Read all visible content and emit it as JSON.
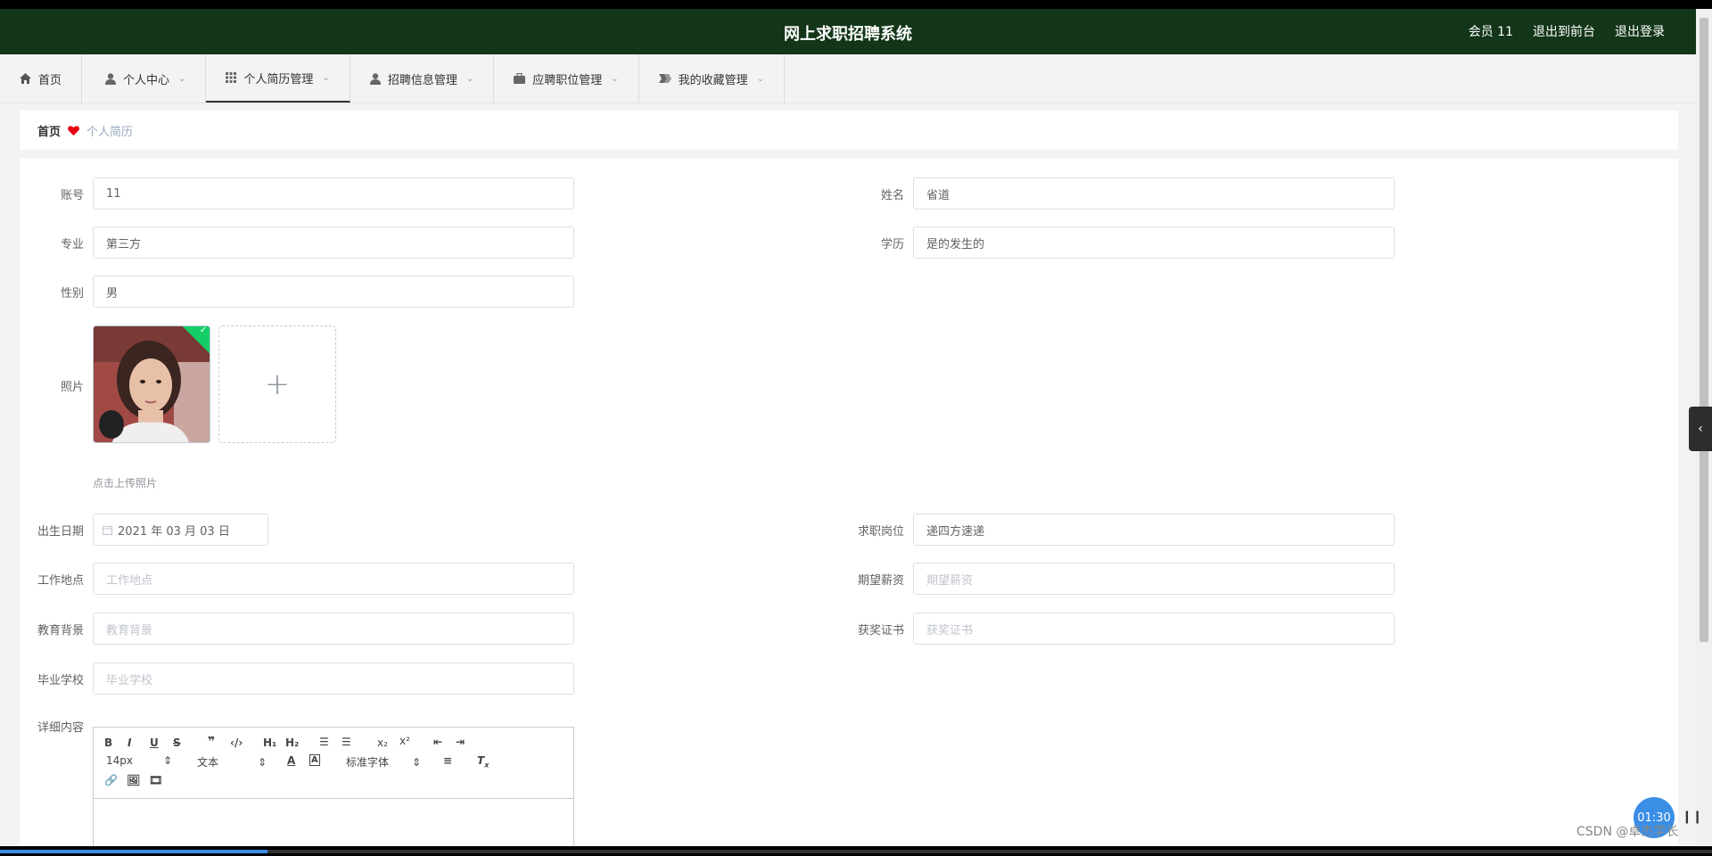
{
  "header": {
    "title": "网上求职招聘系统",
    "member": "会员 11",
    "exit_front": "退出到前台",
    "logout": "退出登录",
    "bg_color": "#133619"
  },
  "nav": {
    "items": [
      {
        "label": "首页",
        "icon": "home-icon"
      },
      {
        "label": "个人中心",
        "icon": "user-icon"
      },
      {
        "label": "个人简历管理",
        "icon": "grid-icon"
      },
      {
        "label": "招聘信息管理",
        "icon": "user-icon"
      },
      {
        "label": "应聘职位管理",
        "icon": "briefcase-icon"
      },
      {
        "label": "我的收藏管理",
        "icon": "bookmark-icon"
      }
    ],
    "active": "个人简历管理"
  },
  "breadcrumb": {
    "home": "首页",
    "current": "个人简历"
  },
  "form": {
    "account": {
      "label": "账号",
      "value": "11"
    },
    "name": {
      "label": "姓名",
      "value": "省道"
    },
    "major": {
      "label": "专业",
      "value": "第三方"
    },
    "education": {
      "label": "学历",
      "value": "是的发生的"
    },
    "gender": {
      "label": "性别",
      "value": "男"
    },
    "photo": {
      "label": "照片",
      "tip": "点击上传照片"
    },
    "birth": {
      "label": "出生日期",
      "value": "2021 年 03 月 03 日"
    },
    "position": {
      "label": "求职岗位",
      "value": "递四方速递"
    },
    "location": {
      "label": "工作地点",
      "placeholder": "工作地点"
    },
    "salary": {
      "label": "期望薪资",
      "placeholder": "期望薪资"
    },
    "background": {
      "label": "教育背景",
      "placeholder": "教育背景"
    },
    "certificate": {
      "label": "获奖证书",
      "placeholder": "获奖证书"
    },
    "school": {
      "label": "毕业学校",
      "placeholder": "毕业学校"
    },
    "detail": {
      "label": "详细内容"
    }
  },
  "editor": {
    "font_size": "14px",
    "header": "文本",
    "font": "标准字体"
  },
  "overlay": {
    "timer": "01:30",
    "watermark": "CSDN @卓杰学长"
  }
}
